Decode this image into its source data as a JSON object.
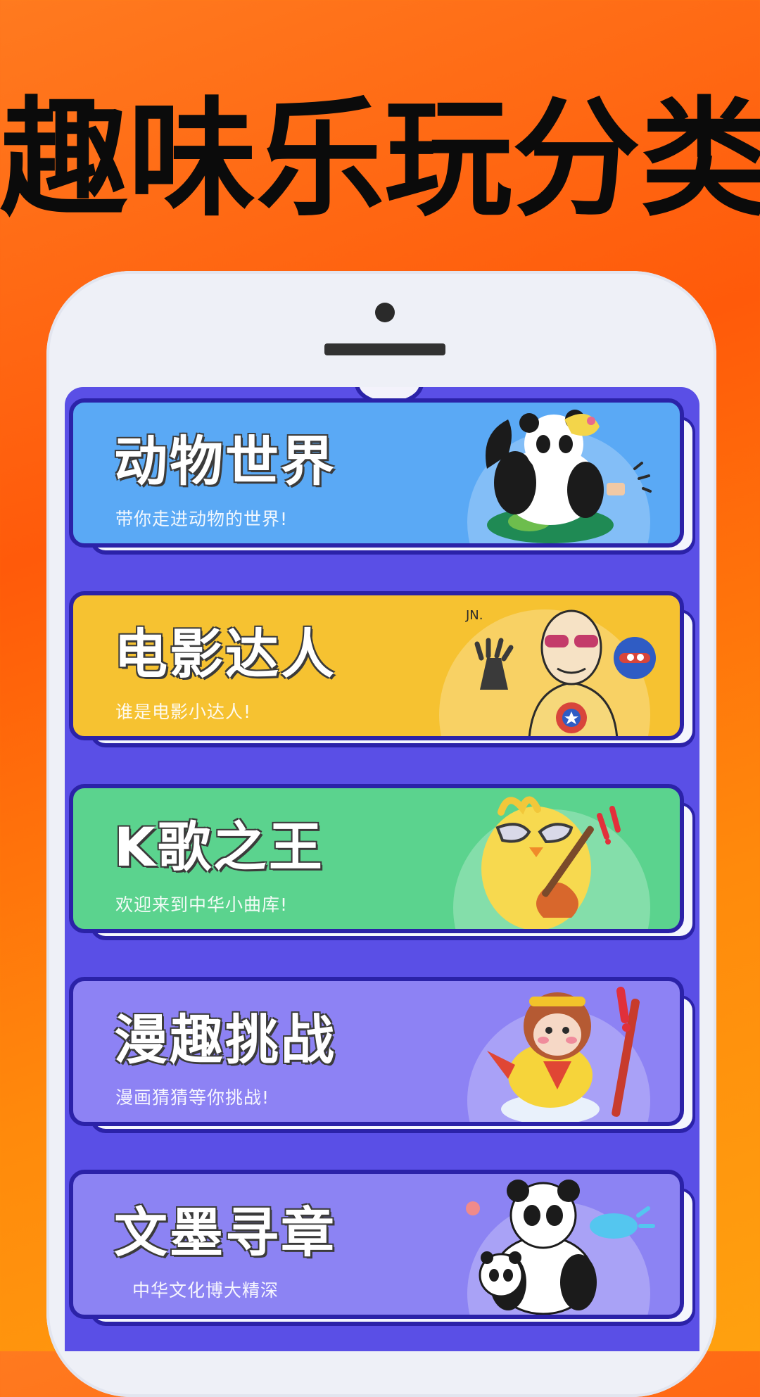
{
  "headline": "趣味乐玩分类",
  "colors": {
    "background": "#ff6a12",
    "screen": "#5a4fe6",
    "outline": "#2b22a8"
  },
  "categories": [
    {
      "title": "动物世界",
      "subtitle": "带你走进动物的世界!",
      "color": "#5aa9f5",
      "icon": "panda-icon"
    },
    {
      "title": "电影达人",
      "subtitle": "谁是电影小达人!",
      "color": "#f6c231",
      "icon": "movie-fan-icon"
    },
    {
      "title": "K歌之王",
      "subtitle": "欢迎来到中华小曲库!",
      "color": "#5bd38e",
      "icon": "guitar-chick-icon"
    },
    {
      "title": "漫趣挑战",
      "subtitle": "漫画猜猜等你挑战!",
      "color": "#8d82f4",
      "icon": "monkey-king-icon"
    },
    {
      "title": "文墨寻章",
      "subtitle": "中华文化博大精深",
      "color": "#8c83f3",
      "icon": "panda-pair-icon"
    }
  ]
}
